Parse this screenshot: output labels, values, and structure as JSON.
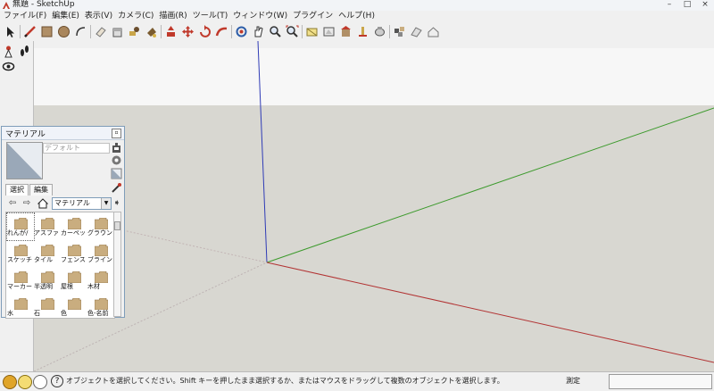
{
  "window": {
    "title": "無題 - SketchUp",
    "controls": [
      "–",
      "□",
      "×"
    ]
  },
  "menubar": [
    "ファイル(F)",
    "編集(E)",
    "表示(V)",
    "カメラ(C)",
    "描画(R)",
    "ツール(T)",
    "ウィンドウ(W)",
    "プラグイン",
    "ヘルプ(H)"
  ],
  "toolbar": {
    "tools": [
      "select-icon",
      "pencil-icon",
      "rectangle-icon",
      "circle-icon",
      "arc-icon",
      "eraser-icon",
      "paint-bucket-icon",
      "tape-measure-icon",
      "paint-bucket-2-icon",
      "push-pull-icon",
      "move-icon",
      "rotate-icon",
      "follow-me-icon",
      "orbit-icon",
      "pan-icon",
      "zoom-icon",
      "zoom-extents-icon",
      "section-icon",
      "views-icon",
      "warehouse-icon",
      "extension-icon",
      "walk-icon",
      "component-icon",
      "style-icon",
      "house-icon"
    ]
  },
  "left_tools": [
    "position-camera-icon",
    "footprints-icon",
    "look-around-icon"
  ],
  "materials": {
    "panel_title": "マテリアル",
    "name_field": "デフォルト",
    "tabs": [
      "選択",
      "編集"
    ],
    "collection": "マテリアル",
    "items": [
      {
        "label": "れんが/"
      },
      {
        "label": "アスファ"
      },
      {
        "label": "カーペット"
      },
      {
        "label": "グラウンド"
      },
      {
        "label": "スケッチ"
      },
      {
        "label": "タイル"
      },
      {
        "label": "フェンス"
      },
      {
        "label": "ブラインド"
      },
      {
        "label": "マーカー"
      },
      {
        "label": "半透明"
      },
      {
        "label": "屋根"
      },
      {
        "label": "木材"
      },
      {
        "label": "水"
      },
      {
        "label": "石"
      },
      {
        "label": "色"
      },
      {
        "label": "色-名前"
      }
    ]
  },
  "status": {
    "hint": "オブジェクトを選択してください。Shift キーを押したまま選択するか、またはマウスをドラッグして複数のオブジェクトを選択します。",
    "measure_label": "測定",
    "measure_value": ""
  },
  "colors": {
    "sky": "#f7f7f7",
    "ground": "#d8d7d1",
    "axis_blue": "#2f3bb6",
    "axis_green": "#3c9a2c",
    "axis_red": "#b23333",
    "folder": "#c9ad7f"
  }
}
